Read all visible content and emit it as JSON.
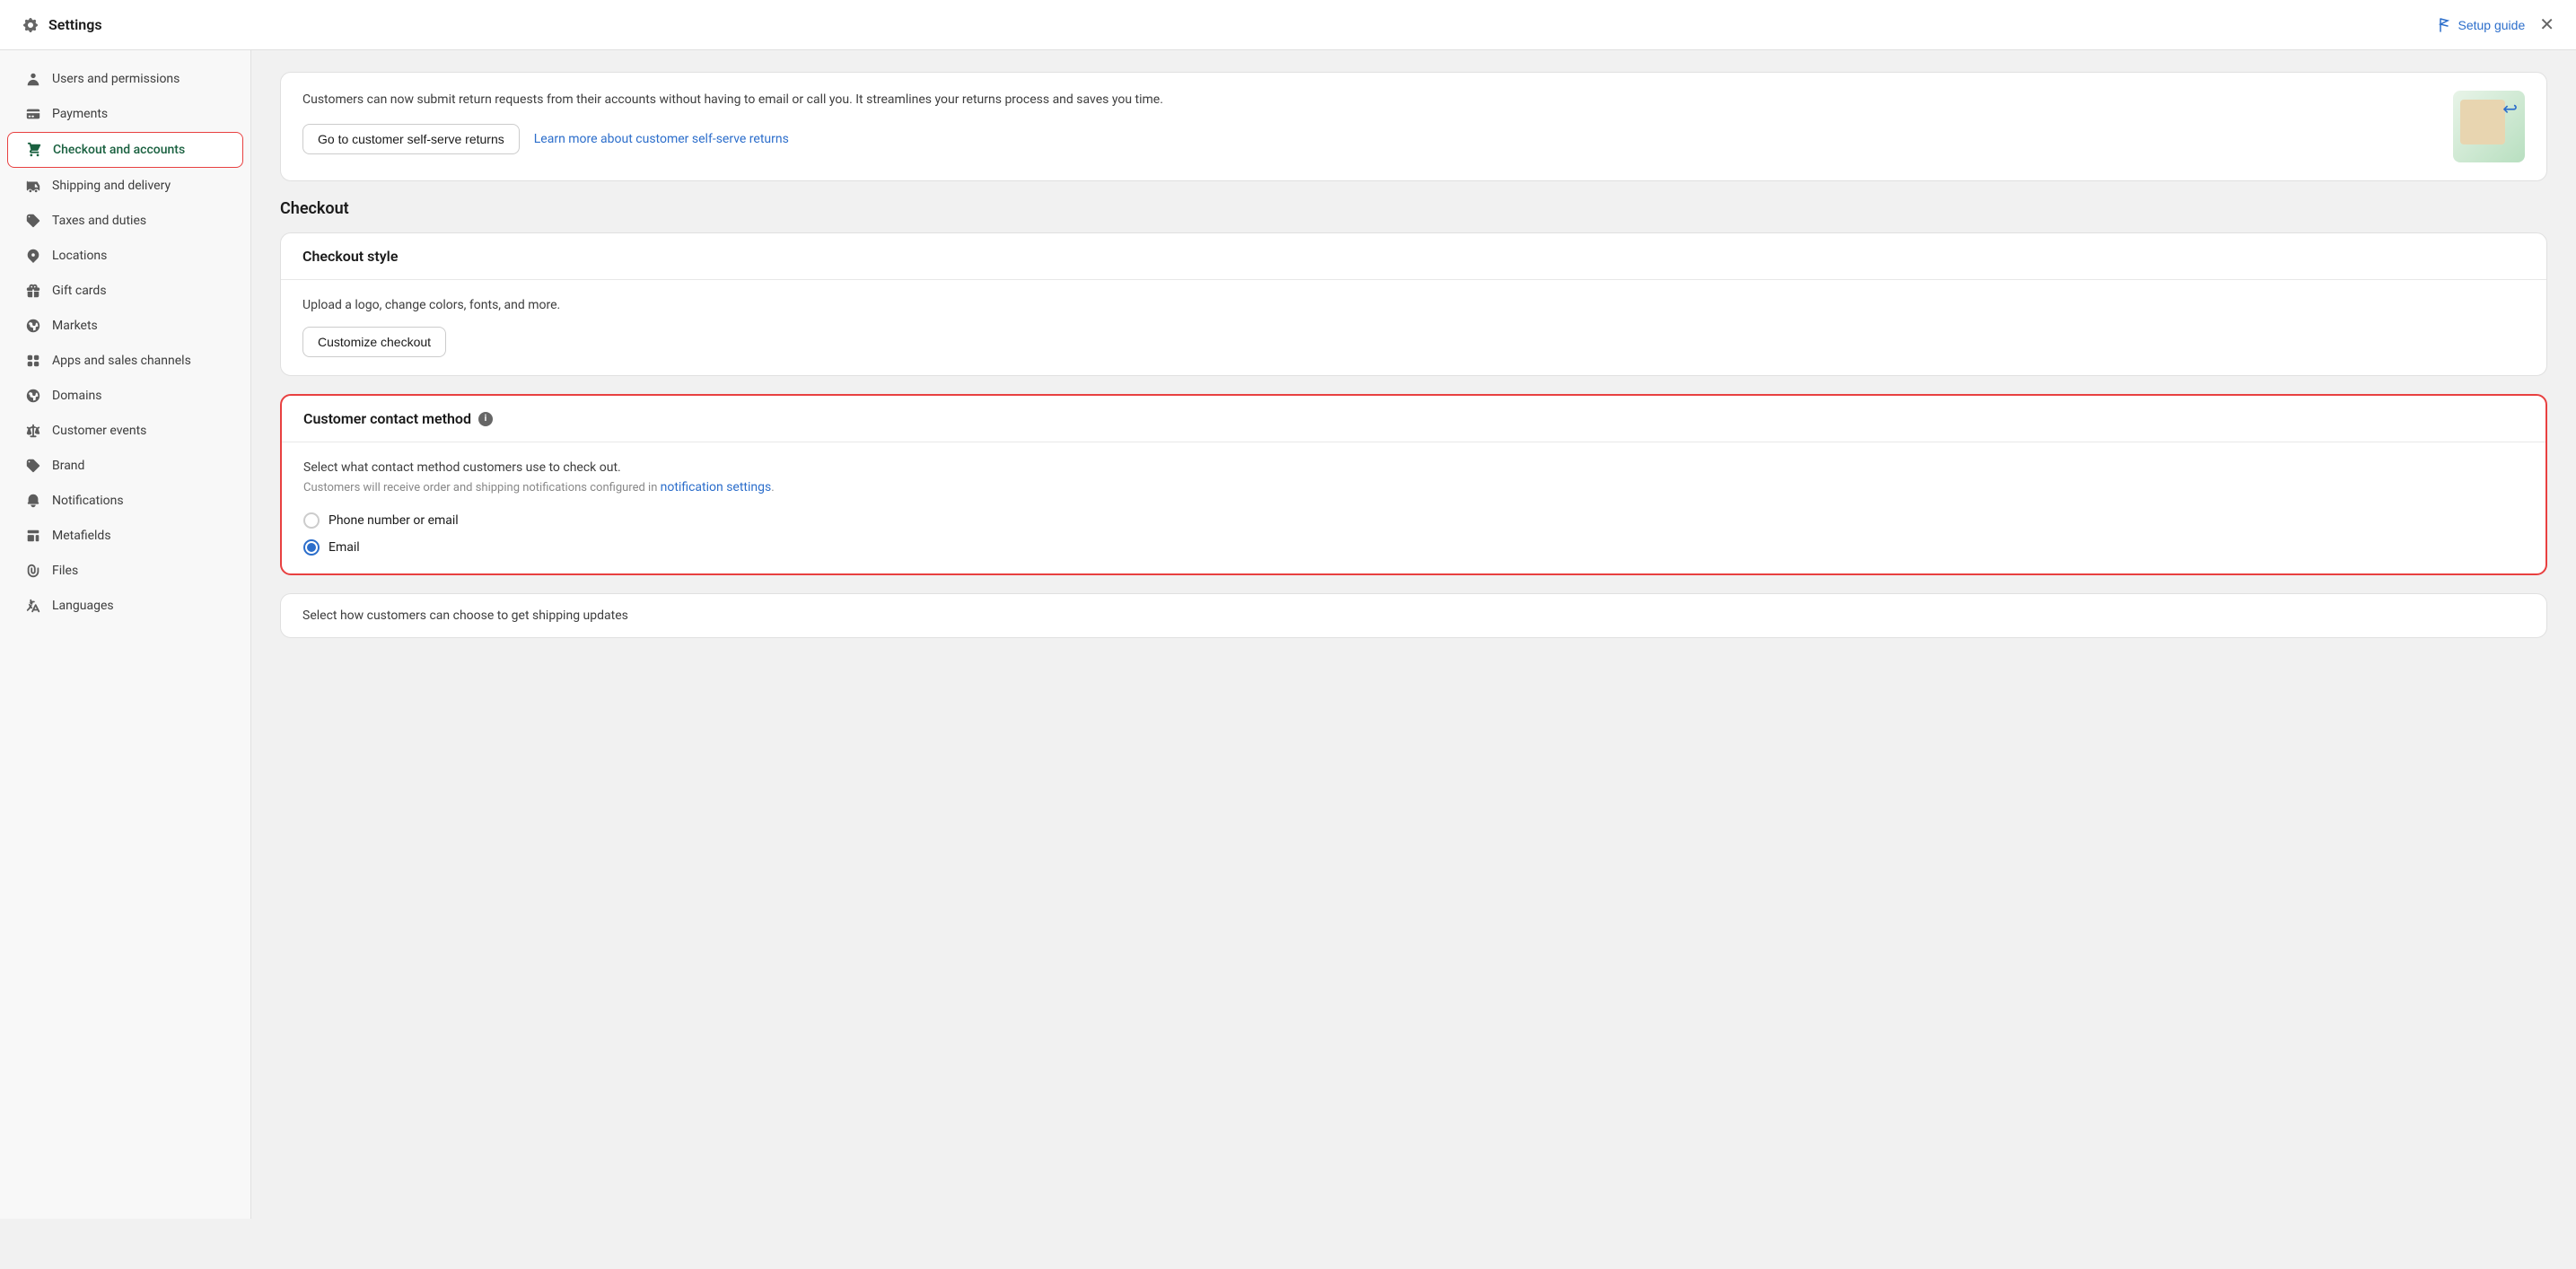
{
  "topbar": {
    "title": "Settings",
    "setup_guide_label": "Setup guide",
    "close_label": "✕"
  },
  "sidebar": {
    "items": [
      {
        "id": "users-permissions",
        "label": "Users and permissions",
        "icon": "person-icon"
      },
      {
        "id": "payments",
        "label": "Payments",
        "icon": "payment-icon"
      },
      {
        "id": "checkout-accounts",
        "label": "Checkout and accounts",
        "icon": "cart-icon",
        "active": true
      },
      {
        "id": "shipping-delivery",
        "label": "Shipping and delivery",
        "icon": "truck-icon"
      },
      {
        "id": "taxes-duties",
        "label": "Taxes and duties",
        "icon": "tag-icon"
      },
      {
        "id": "locations",
        "label": "Locations",
        "icon": "location-icon"
      },
      {
        "id": "gift-cards",
        "label": "Gift cards",
        "icon": "gift-icon"
      },
      {
        "id": "markets",
        "label": "Markets",
        "icon": "globe-icon"
      },
      {
        "id": "apps-sales-channels",
        "label": "Apps and sales channels",
        "icon": "apps-icon"
      },
      {
        "id": "domains",
        "label": "Domains",
        "icon": "globe2-icon"
      },
      {
        "id": "customer-events",
        "label": "Customer events",
        "icon": "events-icon"
      },
      {
        "id": "brand",
        "label": "Brand",
        "icon": "brand-icon"
      },
      {
        "id": "notifications",
        "label": "Notifications",
        "icon": "bell-icon"
      },
      {
        "id": "metafields",
        "label": "Metafields",
        "icon": "metafields-icon"
      },
      {
        "id": "files",
        "label": "Files",
        "icon": "files-icon"
      },
      {
        "id": "languages",
        "label": "Languages",
        "icon": "languages-icon"
      }
    ]
  },
  "main": {
    "return_card": {
      "text": "Customers can now submit return requests from their accounts without having to email or call you. It streamlines your returns process and saves you time.",
      "primary_button": "Go to customer self-serve returns",
      "link_label": "Learn more about customer self-serve returns"
    },
    "checkout_section_title": "Checkout",
    "checkout_style_card": {
      "title": "Checkout style",
      "description": "Upload a logo, change colors, fonts, and more.",
      "button_label": "Customize checkout"
    },
    "contact_method_card": {
      "title": "Customer contact method",
      "description": "Select what contact method customers use to check out.",
      "sub_description": "Customers will receive order and shipping notifications configured in ",
      "notification_link": "notification settings",
      "notification_link_suffix": ".",
      "options": [
        {
          "id": "phone-email",
          "label": "Phone number or email",
          "selected": false
        },
        {
          "id": "email",
          "label": "Email",
          "selected": true
        }
      ]
    },
    "bottom_hint": "Select how customers can choose to get shipping updates"
  },
  "colors": {
    "active_green": "#1a6140",
    "active_border": "#e84040",
    "link_blue": "#2c6ecb"
  },
  "icons": {
    "person": "👤",
    "payment": "💳",
    "cart": "🛒",
    "truck": "🚚",
    "tag": "🏷",
    "location": "📍",
    "gift": "🎁",
    "globe": "🌐",
    "apps": "⊞",
    "domain": "🌐",
    "events": "✦",
    "brand": "🏷",
    "bell": "🔔",
    "metafields": "⊟",
    "files": "📎",
    "languages": "♈"
  }
}
